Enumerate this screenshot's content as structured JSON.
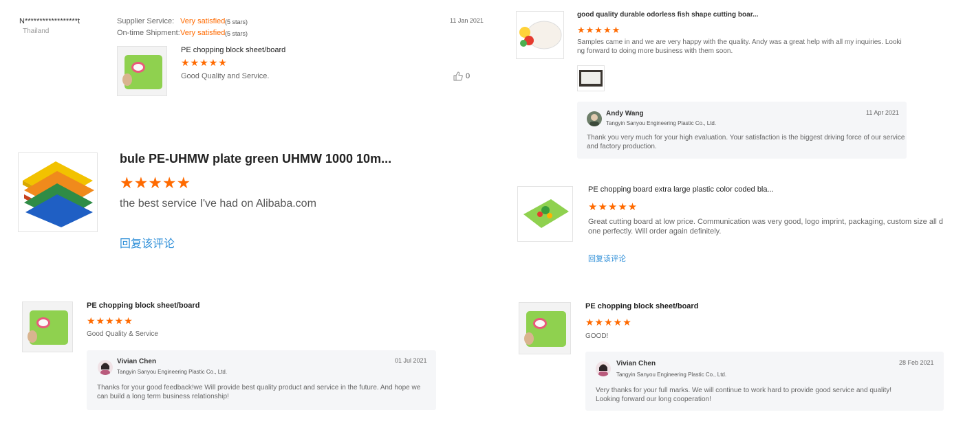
{
  "rev1": {
    "buyer": "N******************t",
    "country": "Thailand",
    "supplier_label": "Supplier Service:",
    "supplier_value": "Very satisfied",
    "supplier_stars": "(5 stars)",
    "shipment_label": "On-time Shipment:",
    "shipment_value": "Very satisfied",
    "shipment_stars": "(5 stars)",
    "date": "11 Jan 2021",
    "product": "PE chopping block sheet/board",
    "stars": "★★★★★",
    "comment": "Good Quality and Service.",
    "likes": "0"
  },
  "rev2": {
    "product": "good quality durable odorless fish shape cutting boar...",
    "stars": "★★★★★",
    "comment_line1": "Samples came in and we are very happy with the quality. Andy was a great help with all my inquiries. Looki",
    "comment_line2": "ng forward to doing more business with them soon.",
    "reply": {
      "name": "Andy Wang",
      "company": "Tangyin Sanyou Engineering Plastic Co., Ltd.",
      "date": "11 Apr 2021",
      "text_line1": "Thank you very much for your high evaluation. Your satisfaction is the biggest driving force of our service",
      "text_line2": "and factory  production."
    }
  },
  "rev3": {
    "product": "bule PE-UHMW plate green UHMW 1000 10m...",
    "stars": "★★★★★",
    "comment": "the best service I've had on Alibaba.com",
    "reply_link": "回复该评论"
  },
  "rev4": {
    "product": "PE chopping board extra large plastic color coded bla...",
    "stars": "★★★★★",
    "comment_line1": "Great cutting board at low price. Communication was very good, logo imprint, packaging, custom size all d",
    "comment_line2": "one perfectly. Will order again definitely.",
    "reply_link": "回复该评论"
  },
  "rev5": {
    "product": "PE chopping block sheet/board",
    "stars": "★★★★★",
    "comment": "Good Quality & Service",
    "reply": {
      "name": "Vivian Chen",
      "company": "Tangyin Sanyou Engineering Plastic Co., Ltd.",
      "date": "01 Jul 2021",
      "text_line1": "Thanks for your good feedback!we Will provide best quality product and service in the future. And hope we",
      "text_line2": "can build a long term business relationship!"
    }
  },
  "rev6": {
    "product": "PE chopping block sheet/board",
    "stars": "★★★★★",
    "comment": "GOOD!",
    "reply": {
      "name": "Vivian Chen",
      "company": "Tangyin Sanyou Engineering Plastic Co., Ltd.",
      "date": "28 Feb 2021",
      "text_line1": "Very thanks for your full marks. We will continue to work hard to provide good service and quality!",
      "text_line2": "Looking forward our long cooperation!"
    }
  },
  "colors": {
    "accent": "#ff6a00",
    "link": "#2f8fd8",
    "reply_bg": "#f5f6f8"
  },
  "icons": [
    "thumbs-up-icon",
    "avatar-icon",
    "product-thumbnail"
  ]
}
